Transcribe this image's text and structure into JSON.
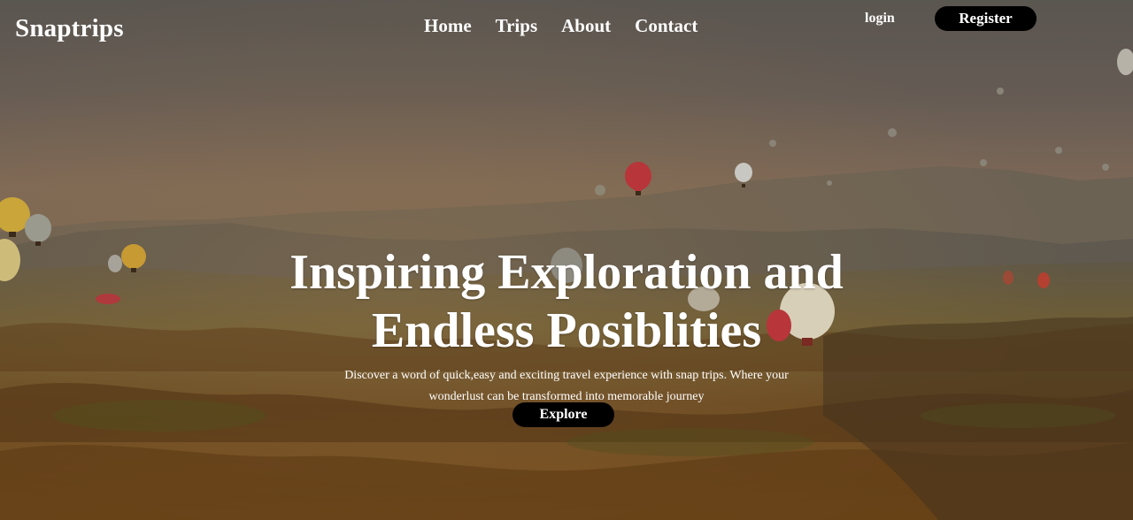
{
  "header": {
    "logo": "Snaptrips",
    "nav": [
      "Home",
      "Trips",
      "About",
      "Contact"
    ],
    "login": "login",
    "register": "Register"
  },
  "hero": {
    "title_line1": "Inspiring Exploration and",
    "title_line2": "Endless Posiblities",
    "description": "Discover a word of quick,easy and exciting travel experience with snap trips. Where your wonderlust can be transformed into memorable journey",
    "cta": "Explore"
  },
  "colors": {
    "button_bg": "#000000",
    "text": "#ffffff",
    "sky": "#6f6558",
    "valley": "#8a5a28"
  },
  "icons": [
    "hot-air-balloon-icon"
  ]
}
